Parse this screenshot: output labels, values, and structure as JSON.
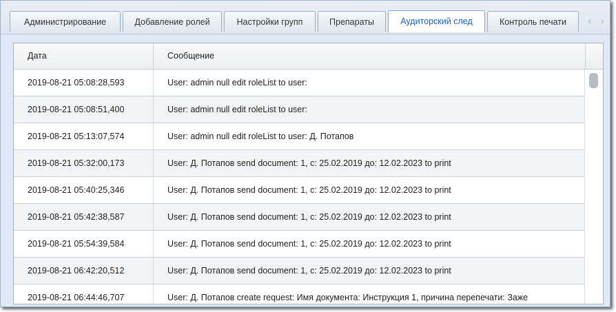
{
  "tabs": [
    {
      "label": "Администрирование"
    },
    {
      "label": "Добавление ролей"
    },
    {
      "label": "Настройки групп"
    },
    {
      "label": "Препараты"
    },
    {
      "label": "Аудиторский след"
    },
    {
      "label": "Контроль печати"
    }
  ],
  "active_tab_index": 4,
  "tab_scroll": {
    "left_icon": "chevron-left-icon",
    "right_icon": "chevron-right-icon",
    "left_glyph": "‹",
    "right_glyph": "›"
  },
  "grid": {
    "columns": [
      "Дата",
      "Сообщение"
    ],
    "rows": [
      {
        "date": "2019-08-21 05:08:28,593",
        "message": "User: admin null edit roleList to user:"
      },
      {
        "date": "2019-08-21 05:08:51,400",
        "message": "User: admin null edit roleList to user:"
      },
      {
        "date": "2019-08-21 05:13:07,574",
        "message": "User: admin null edit roleList to user: Д. Потапов"
      },
      {
        "date": "2019-08-21 05:32:00,173",
        "message": "User: Д. Потапов send document: 1, с: 25.02.2019 до: 12.02.2023 to print"
      },
      {
        "date": "2019-08-21 05:40:25,346",
        "message": "User: Д. Потапов send document: 1, с: 25.02.2019 до: 12.02.2023 to print"
      },
      {
        "date": "2019-08-21 05:42:38,587",
        "message": "User: Д. Потапов send document: 1, с: 25.02.2019 до: 12.02.2023 to print"
      },
      {
        "date": "2019-08-21 05:54:39,584",
        "message": "User: Д. Потапов send document: 1, с: 25.02.2019 до: 12.02.2023 to print"
      },
      {
        "date": "2019-08-21 06:42:20,512",
        "message": "User: Д. Потапов send document: 1, с: 25.02.2019 до: 12.02.2023 to print"
      },
      {
        "date": "2019-08-21 06:44:46,707",
        "message": "User: Д. Потапов create request: Имя документа: Инструкция 1, причина перепечати: Заже"
      }
    ]
  },
  "colors": {
    "active_tab_text": "#1b64c2",
    "alt_row": "#f2f3f4",
    "frame_bg": "#dfe8f6"
  }
}
